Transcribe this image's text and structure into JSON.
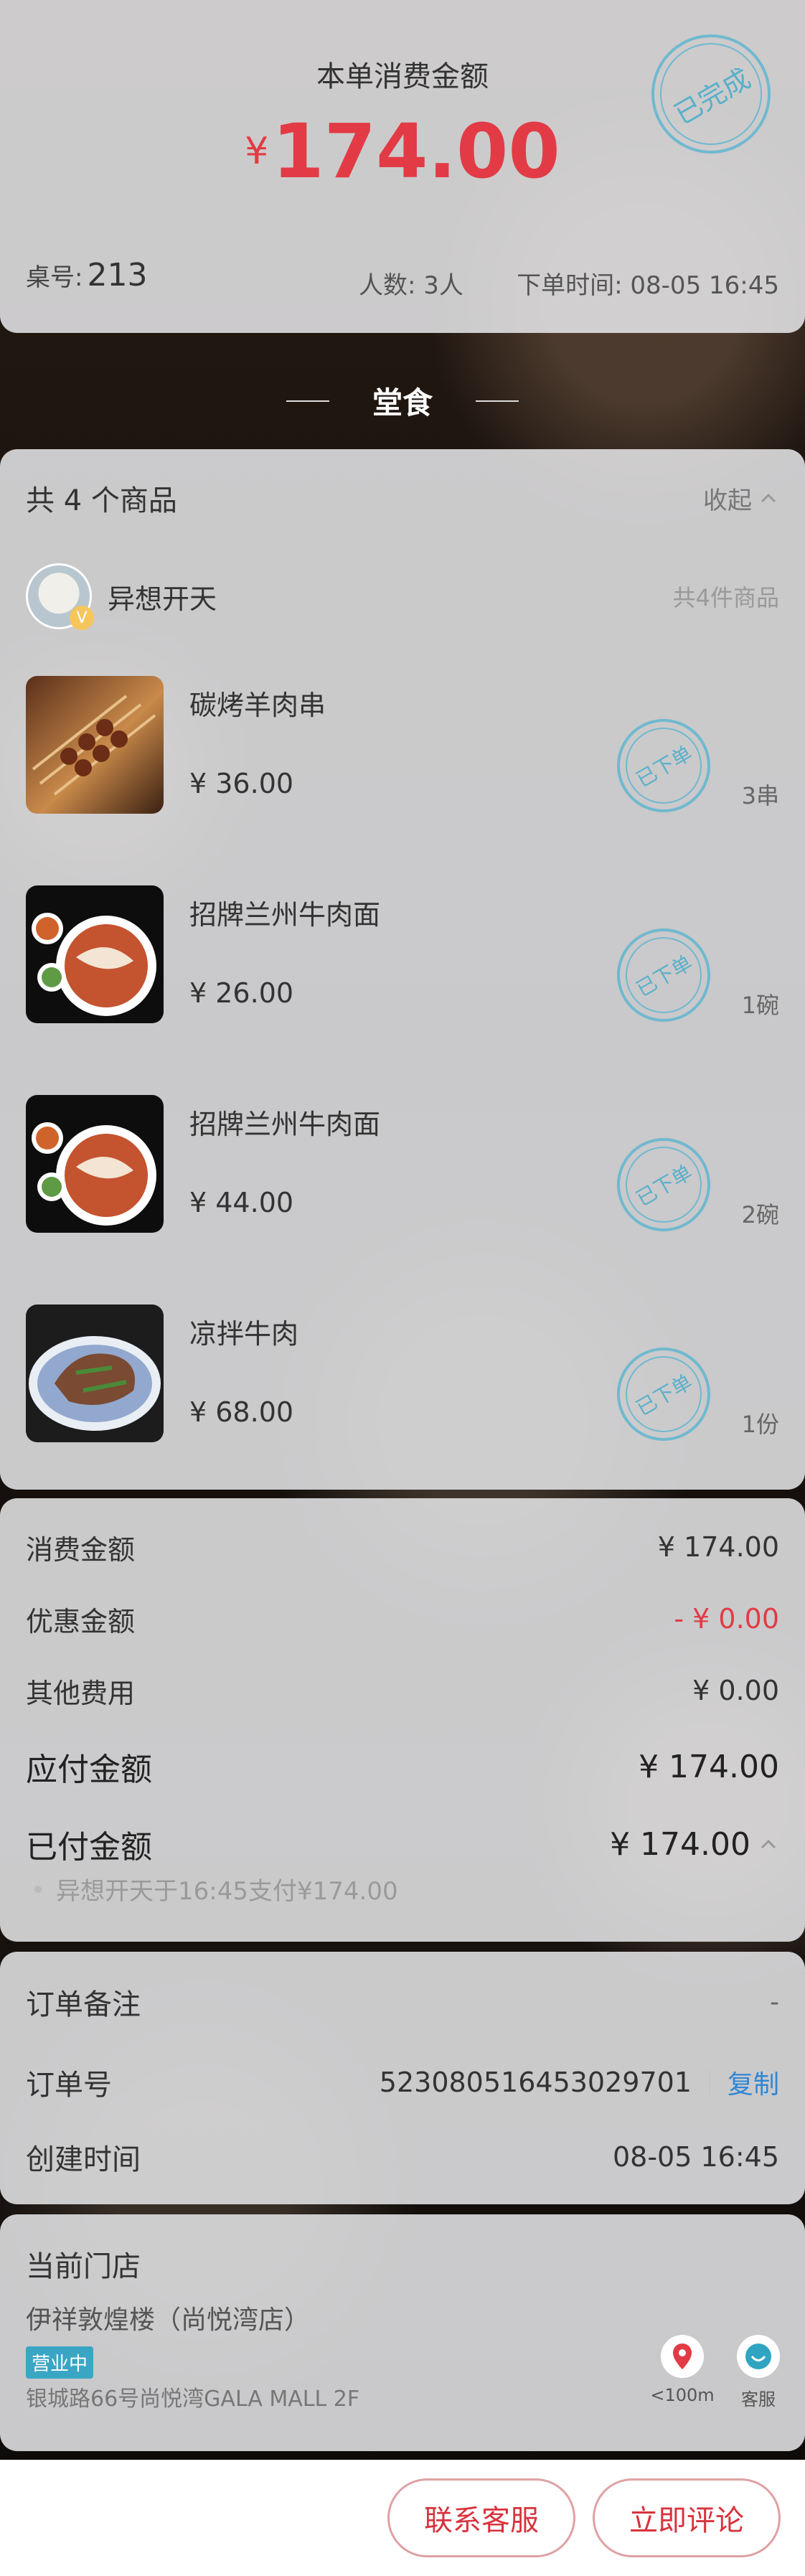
{
  "header": {
    "title": "本单消费金额",
    "currency": "¥",
    "amount": "174.00",
    "stamp": "已完成",
    "table_label": "桌号:",
    "table_no": "213",
    "people": "人数: 3人",
    "order_time": "下单时间: 08-05 16:45"
  },
  "dine_mode": "堂食",
  "items_section": {
    "count_label": "共 4 个商品",
    "collapse_label": "收起",
    "merchant_name": "异想开天",
    "merchant_count": "共4件商品",
    "items": [
      {
        "name": "碳烤羊肉串",
        "price": "¥ 36.00",
        "qty": "3串",
        "stamp": "已下单"
      },
      {
        "name": "招牌兰州牛肉面",
        "price": "¥ 26.00",
        "qty": "1碗",
        "stamp": "已下单"
      },
      {
        "name": "招牌兰州牛肉面",
        "price": "¥ 44.00",
        "qty": "2碗",
        "stamp": "已下单"
      },
      {
        "name": "凉拌牛肉",
        "price": "¥ 68.00",
        "qty": "1份",
        "stamp": "已下单"
      }
    ]
  },
  "summary": {
    "consume_label": "消费金额",
    "consume_value": "¥ 174.00",
    "discount_label": "优惠金额",
    "discount_value": "- ¥ 0.00",
    "other_label": "其他费用",
    "other_value": "¥ 0.00",
    "payable_label": "应付金额",
    "payable_value": "¥ 174.00",
    "paid_label": "已付金额",
    "paid_value": "¥ 174.00",
    "paid_note": "异想开天于16:45支付¥174.00"
  },
  "order_info": {
    "remark_label": "订单备注",
    "remark_value": "-",
    "order_no_label": "订单号",
    "order_no": "523080516453029701",
    "copy_label": "复制",
    "created_label": "创建时间",
    "created_value": "08-05 16:45"
  },
  "store": {
    "section_title": "当前门店",
    "name": "伊祥敦煌楼（尚悦湾店）",
    "status_badge": "营业中",
    "address": "银城路66号尚悦湾GALA MALL 2F",
    "distance": "<100m",
    "service_label": "客服"
  },
  "actions": {
    "contact_label": "联系客服",
    "review_label": "立即评论"
  },
  "colors": {
    "price_red": "#e23b45",
    "stamp_blue": "#5ab0c9",
    "link_blue": "#2f86d6"
  }
}
